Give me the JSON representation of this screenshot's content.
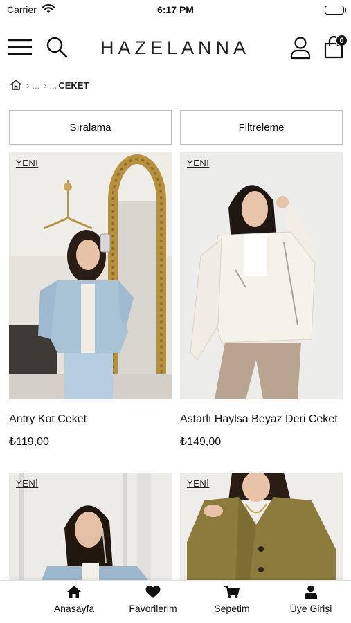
{
  "status": {
    "carrier": "Carrier",
    "time": "6:17 PM"
  },
  "header": {
    "brand": "HAZELANNA",
    "cart_count": "0"
  },
  "breadcrumb": {
    "level1": "...",
    "level2": "...",
    "current": "CEKET"
  },
  "actions": {
    "sort_label": "Sıralama",
    "filter_label": "Filtreleme"
  },
  "products": [
    {
      "badge": "YENİ",
      "title": "Antry Kot Ceket",
      "price": "₺119,00"
    },
    {
      "badge": "YENİ",
      "title": "Astarlı Haylsa Beyaz Deri Ceket",
      "price": "₺149,00"
    },
    {
      "badge": "YENİ",
      "title": "",
      "price": ""
    },
    {
      "badge": "YENİ",
      "title": "",
      "price": ""
    }
  ],
  "tabbar": {
    "home": "Anasayfa",
    "favorites": "Favorilerim",
    "cart": "Sepetim",
    "account": "Üye Girişi"
  },
  "colors": {
    "text": "#111111",
    "border": "#bdbdbd",
    "background": "#ffffff"
  }
}
